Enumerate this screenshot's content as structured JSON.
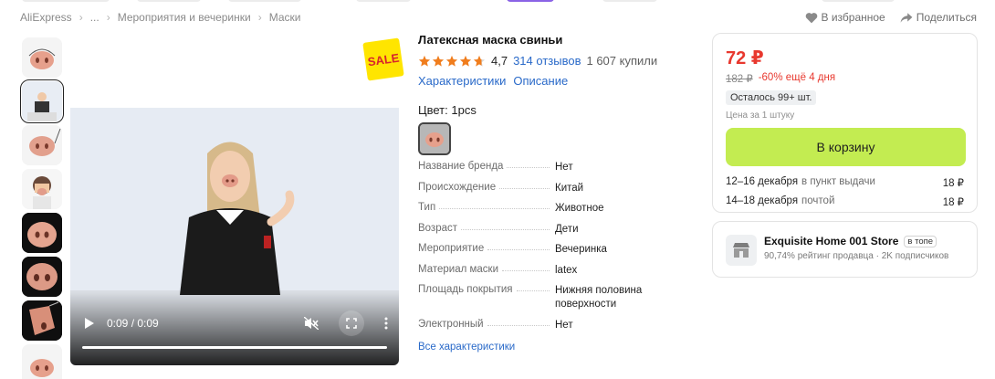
{
  "breadcrumb": {
    "items": [
      "AliExpress",
      "...",
      "Мероприятия и вечеринки",
      "Маски"
    ]
  },
  "actions": {
    "favorite_label": "В избранное",
    "share_label": "Поделиться"
  },
  "gallery": {
    "thumbnail_count": 8,
    "active_index": 1
  },
  "video": {
    "time_display": "0:09 / 0:09",
    "progress": 1.0
  },
  "sale_badge": "SALE",
  "product": {
    "title": "Латексная маска свиньи",
    "rating": "4,7",
    "rating_value": 4.7,
    "reviews": "314 отзывов",
    "purchased": "1 607 купили",
    "tab_characteristics": "Характеристики",
    "tab_description": "Описание",
    "color_label": "Цвет: 1pcs"
  },
  "specs": [
    {
      "key": "Название бренда",
      "value": "Нет"
    },
    {
      "key": "Происхождение",
      "value": "Китай"
    },
    {
      "key": "Тип",
      "value": "Животное"
    },
    {
      "key": "Возраст",
      "value": "Дети"
    },
    {
      "key": "Мероприятие",
      "value": "Вечеринка"
    },
    {
      "key": "Материал маски",
      "value": "latex"
    },
    {
      "key": "Площадь покрытия",
      "value": "Нижняя половина поверхности"
    },
    {
      "key": "Электронный",
      "value": "Нет"
    }
  ],
  "all_specs_link": "Все характеристики",
  "buybox": {
    "price": "72 ₽",
    "old_price": "182 ₽",
    "discount": "-60% ещё 4 дня",
    "stock": "Осталось 99+ шт.",
    "unit_price": "Цена за 1 штуку",
    "cart_button": "В корзину",
    "shipping": [
      {
        "dates": "12–16 декабря",
        "method": "в пункт выдачи",
        "price": "18 ₽"
      },
      {
        "dates": "14–18 декабря",
        "method": "почтой",
        "price": "18 ₽"
      }
    ]
  },
  "seller": {
    "name": "Exquisite Home 001 Store",
    "badge": "в топе",
    "stats": "90,74% рейтинг продавца · 2K подписчиков"
  },
  "colors": {
    "price_red": "#e8382e",
    "cart_green": "#c3ec51",
    "link_blue": "#2a6ac9",
    "star_orange": "#f07d1d"
  }
}
